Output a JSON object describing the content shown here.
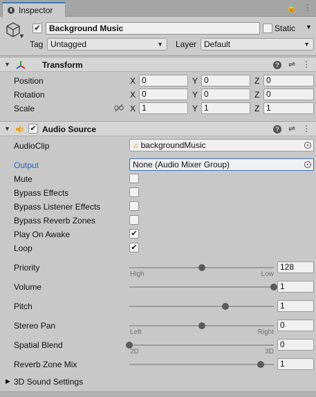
{
  "window": {
    "tab_title": "Inspector",
    "tab_icon": "info-icon",
    "controls": [
      "lock-icon",
      "menu-icon"
    ]
  },
  "gameobject": {
    "active": true,
    "name": "Background Music",
    "static_checked": false,
    "static_label": "Static",
    "tag_label": "Tag",
    "tag_value": "Untagged",
    "layer_label": "Layer",
    "layer_value": "Default"
  },
  "transform": {
    "title": "Transform",
    "rows": [
      {
        "label": "Position",
        "x": "0",
        "y": "0",
        "z": "0"
      },
      {
        "label": "Rotation",
        "x": "0",
        "y": "0",
        "z": "0"
      },
      {
        "label": "Scale",
        "x": "1",
        "y": "1",
        "z": "1"
      }
    ],
    "axis_x": "X",
    "axis_y": "Y",
    "axis_z": "Z"
  },
  "audio_source": {
    "title": "Audio Source",
    "enabled": true,
    "audioclip_label": "AudioClip",
    "audioclip_value": "backgroundMusic",
    "output_label": "Output",
    "output_value": "None (Audio Mixer Group)",
    "toggles": [
      {
        "label": "Mute",
        "checked": false
      },
      {
        "label": "Bypass Effects",
        "checked": false
      },
      {
        "label": "Bypass Listener Effects",
        "checked": false
      },
      {
        "label": "Bypass Reverb Zones",
        "checked": false
      },
      {
        "label": "Play On Awake",
        "checked": true
      },
      {
        "label": "Loop",
        "checked": true
      }
    ],
    "sliders": [
      {
        "label": "Priority",
        "value": "128",
        "fraction": 0.5,
        "left": "High",
        "right": "Low"
      },
      {
        "label": "Volume",
        "value": "1",
        "fraction": 1.0
      },
      {
        "label": "Pitch",
        "value": "1",
        "fraction": 0.667
      },
      {
        "label": "Stereo Pan",
        "value": "0",
        "fraction": 0.5,
        "left": "Left",
        "right": "Right"
      },
      {
        "label": "Spatial Blend",
        "value": "0",
        "fraction": 0.0,
        "left": "2D",
        "right": "3D"
      },
      {
        "label": "Reverb Zone Mix",
        "value": "1",
        "fraction": 0.909
      }
    ],
    "foldout": "3D Sound Settings"
  },
  "colors": {
    "output_label": "#2b63b8",
    "transform_icon_red": "#d23a2a",
    "transform_icon_green": "#3aa53a",
    "transform_icon_blue": "#2f5fd0",
    "audio_icon": "#e6a21e"
  }
}
